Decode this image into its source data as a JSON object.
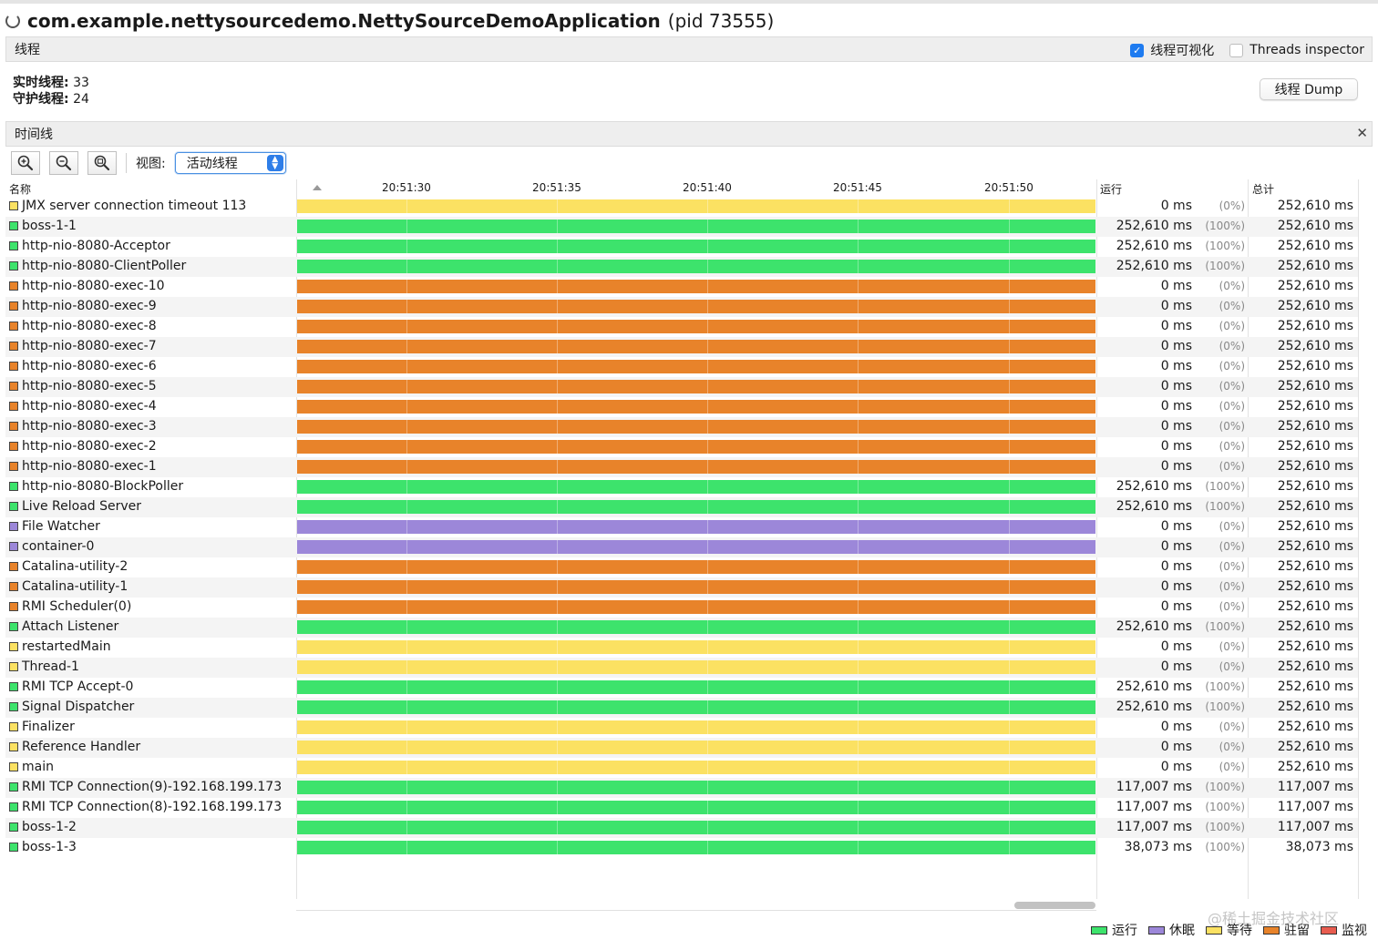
{
  "app": {
    "title": "com.example.nettysourcedemo.NettySourceDemoApplication",
    "pid": "(pid 73555)"
  },
  "threads_panel": {
    "label": "线程",
    "visualize_label": "线程可视化",
    "visualize_checked": true,
    "inspector_label": "Threads inspector",
    "inspector_checked": false,
    "live_label": "实时线程:",
    "live_value": "33",
    "daemon_label": "守护线程:",
    "daemon_value": "24",
    "dump_button": "线程 Dump"
  },
  "timeline_panel": {
    "label": "时间线",
    "view_label": "视图:",
    "view_selected": "活动线程",
    "columns": {
      "name": "名称",
      "running": "运行",
      "total": "总计"
    },
    "ticks": [
      "20:51:30",
      "20:51:35",
      "20:51:40",
      "20:51:45",
      "20:51:50"
    ]
  },
  "state_colors": {
    "running": "#3de36c",
    "sleeping": "#9c87d9",
    "waiting": "#fbe162",
    "parked": "#e8832a",
    "monitor": "#e85c4f"
  },
  "legend": [
    {
      "state": "running",
      "label": "运行"
    },
    {
      "state": "sleeping",
      "label": "休眠"
    },
    {
      "state": "waiting",
      "label": "等待"
    },
    {
      "state": "parked",
      "label": "驻留"
    },
    {
      "state": "monitor",
      "label": "监视"
    }
  ],
  "watermark": "@稀土掘金技术社区",
  "threads": [
    {
      "name": "JMX server connection timeout 113",
      "state": "waiting",
      "running": "0 ms",
      "pct": "(0%)",
      "total": "252,610 ms"
    },
    {
      "name": "boss-1-1",
      "state": "running",
      "running": "252,610 ms",
      "pct": "(100%)",
      "total": "252,610 ms"
    },
    {
      "name": "http-nio-8080-Acceptor",
      "state": "running",
      "running": "252,610 ms",
      "pct": "(100%)",
      "total": "252,610 ms"
    },
    {
      "name": "http-nio-8080-ClientPoller",
      "state": "running",
      "running": "252,610 ms",
      "pct": "(100%)",
      "total": "252,610 ms"
    },
    {
      "name": "http-nio-8080-exec-10",
      "state": "parked",
      "running": "0 ms",
      "pct": "(0%)",
      "total": "252,610 ms"
    },
    {
      "name": "http-nio-8080-exec-9",
      "state": "parked",
      "running": "0 ms",
      "pct": "(0%)",
      "total": "252,610 ms"
    },
    {
      "name": "http-nio-8080-exec-8",
      "state": "parked",
      "running": "0 ms",
      "pct": "(0%)",
      "total": "252,610 ms"
    },
    {
      "name": "http-nio-8080-exec-7",
      "state": "parked",
      "running": "0 ms",
      "pct": "(0%)",
      "total": "252,610 ms"
    },
    {
      "name": "http-nio-8080-exec-6",
      "state": "parked",
      "running": "0 ms",
      "pct": "(0%)",
      "total": "252,610 ms"
    },
    {
      "name": "http-nio-8080-exec-5",
      "state": "parked",
      "running": "0 ms",
      "pct": "(0%)",
      "total": "252,610 ms"
    },
    {
      "name": "http-nio-8080-exec-4",
      "state": "parked",
      "running": "0 ms",
      "pct": "(0%)",
      "total": "252,610 ms"
    },
    {
      "name": "http-nio-8080-exec-3",
      "state": "parked",
      "running": "0 ms",
      "pct": "(0%)",
      "total": "252,610 ms"
    },
    {
      "name": "http-nio-8080-exec-2",
      "state": "parked",
      "running": "0 ms",
      "pct": "(0%)",
      "total": "252,610 ms"
    },
    {
      "name": "http-nio-8080-exec-1",
      "state": "parked",
      "running": "0 ms",
      "pct": "(0%)",
      "total": "252,610 ms"
    },
    {
      "name": "http-nio-8080-BlockPoller",
      "state": "running",
      "running": "252,610 ms",
      "pct": "(100%)",
      "total": "252,610 ms"
    },
    {
      "name": "Live Reload Server",
      "state": "running",
      "running": "252,610 ms",
      "pct": "(100%)",
      "total": "252,610 ms"
    },
    {
      "name": "File Watcher",
      "state": "sleeping",
      "running": "0 ms",
      "pct": "(0%)",
      "total": "252,610 ms"
    },
    {
      "name": "container-0",
      "state": "sleeping",
      "running": "0 ms",
      "pct": "(0%)",
      "total": "252,610 ms"
    },
    {
      "name": "Catalina-utility-2",
      "state": "parked",
      "running": "0 ms",
      "pct": "(0%)",
      "total": "252,610 ms"
    },
    {
      "name": "Catalina-utility-1",
      "state": "parked",
      "running": "0 ms",
      "pct": "(0%)",
      "total": "252,610 ms"
    },
    {
      "name": "RMI Scheduler(0)",
      "state": "parked",
      "running": "0 ms",
      "pct": "(0%)",
      "total": "252,610 ms"
    },
    {
      "name": "Attach Listener",
      "state": "running",
      "running": "252,610 ms",
      "pct": "(100%)",
      "total": "252,610 ms"
    },
    {
      "name": "restartedMain",
      "state": "waiting",
      "running": "0 ms",
      "pct": "(0%)",
      "total": "252,610 ms"
    },
    {
      "name": "Thread-1",
      "state": "waiting",
      "running": "0 ms",
      "pct": "(0%)",
      "total": "252,610 ms"
    },
    {
      "name": "RMI TCP Accept-0",
      "state": "running",
      "running": "252,610 ms",
      "pct": "(100%)",
      "total": "252,610 ms"
    },
    {
      "name": "Signal Dispatcher",
      "state": "running",
      "running": "252,610 ms",
      "pct": "(100%)",
      "total": "252,610 ms"
    },
    {
      "name": "Finalizer",
      "state": "waiting",
      "running": "0 ms",
      "pct": "(0%)",
      "total": "252,610 ms"
    },
    {
      "name": "Reference Handler",
      "state": "waiting",
      "running": "0 ms",
      "pct": "(0%)",
      "total": "252,610 ms"
    },
    {
      "name": "main",
      "state": "waiting",
      "running": "0 ms",
      "pct": "(0%)",
      "total": "252,610 ms"
    },
    {
      "name": "RMI TCP Connection(9)-192.168.199.173",
      "state": "running",
      "running": "117,007 ms",
      "pct": "(100%)",
      "total": "117,007 ms"
    },
    {
      "name": "RMI TCP Connection(8)-192.168.199.173",
      "state": "running",
      "running": "117,007 ms",
      "pct": "(100%)",
      "total": "117,007 ms"
    },
    {
      "name": "boss-1-2",
      "state": "running",
      "running": "117,007 ms",
      "pct": "(100%)",
      "total": "117,007 ms"
    },
    {
      "name": "boss-1-3",
      "state": "running",
      "running": "38,073 ms",
      "pct": "(100%)",
      "total": "38,073 ms"
    }
  ]
}
